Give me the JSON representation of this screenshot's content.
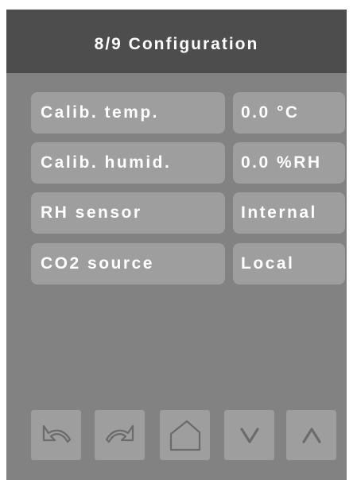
{
  "header": {
    "title": "8/9 Configuration"
  },
  "rows": [
    {
      "label": "Calib. temp.",
      "value": "0.0 °C"
    },
    {
      "label": "Calib. humid.",
      "value": "0.0 %RH"
    },
    {
      "label": "RH sensor",
      "value": "Internal"
    },
    {
      "label": "CO2 source",
      "value": "Local"
    }
  ],
  "nav": {
    "buttons": [
      "undo-icon",
      "redo-icon",
      "home-icon",
      "chevron-down-icon",
      "chevron-up-icon"
    ]
  },
  "colors": {
    "header_bg": "#4d4d4d",
    "screen_bg": "#828282",
    "tile_bg": "#9e9e9e",
    "text": "#ffffff",
    "icon": "#6b6b6b"
  }
}
